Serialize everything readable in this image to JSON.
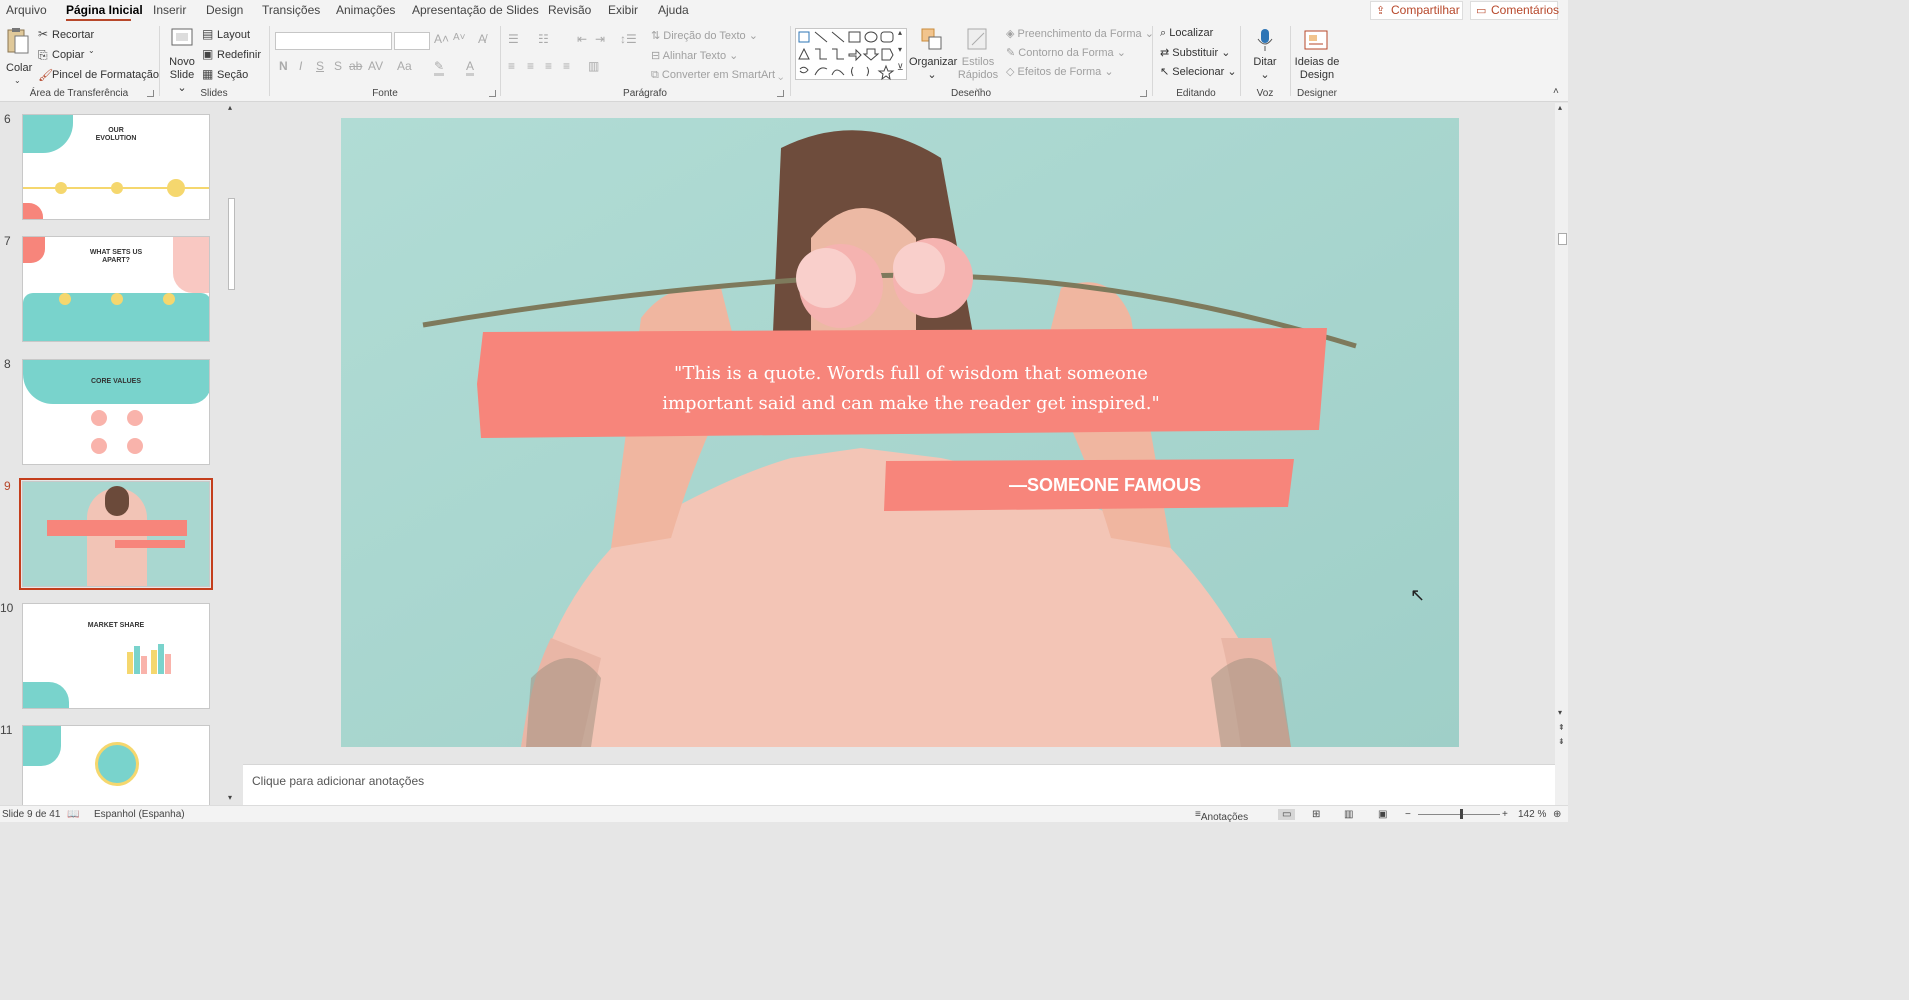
{
  "tabs": [
    "Arquivo",
    "Página Inicial",
    "Inserir",
    "Design",
    "Transições",
    "Animações",
    "Apresentação de Slides",
    "Revisão",
    "Exibir",
    "Ajuda"
  ],
  "share_label": "Compartilhar",
  "comments_label": "Comentários",
  "ribbon": {
    "clipboard": {
      "paste": "Colar",
      "cut": "Recortar",
      "copy": "Copiar",
      "format_painter": "Pincel de Formatação",
      "group": "Área de Transferência"
    },
    "slides": {
      "new_slide_1": "Novo",
      "new_slide_2": "Slide",
      "layout": "Layout",
      "reset": "Redefinir",
      "section": "Seção",
      "group": "Slides"
    },
    "font": {
      "group": "Fonte"
    },
    "paragraph": {
      "text_direction": "Direção do Texto",
      "align_text": "Alinhar Texto",
      "smartart": "Converter em SmartArt",
      "group": "Parágrafo"
    },
    "drawing": {
      "arrange": "Organizar",
      "quick_styles_1": "Estilos",
      "quick_styles_2": "Rápidos",
      "fill": "Preenchimento da Forma",
      "outline": "Contorno da Forma",
      "effects": "Efeitos de Forma",
      "group": "Desenho"
    },
    "editing": {
      "find": "Localizar",
      "replace": "Substituir",
      "select": "Selecionar",
      "group": "Editando"
    },
    "voice": {
      "dictate": "Ditar",
      "group": "Voz"
    },
    "designer": {
      "ideas_1": "Ideias de",
      "ideas_2": "Design",
      "group": "Designer"
    }
  },
  "slides_panel": [
    {
      "num": "6",
      "title": "OUR EVOLUTION"
    },
    {
      "num": "7",
      "title": "WHAT SETS US APART?"
    },
    {
      "num": "8",
      "title": "CORE VALUES"
    },
    {
      "num": "9",
      "title": ""
    },
    {
      "num": "10",
      "title": "MARKET SHARE"
    },
    {
      "num": "11",
      "title": ""
    }
  ],
  "slide": {
    "quote_line1": "\"This is a quote. Words full of wisdom that someone",
    "quote_line2": "important said and can make the reader get inspired.\"",
    "author": "—SOMEONE FAMOUS"
  },
  "notes_placeholder": "Clique para adicionar anotações",
  "status": {
    "slide_info": "Slide 9 de 41",
    "language": "Espanhol (Espanha)",
    "notes": "Anotações",
    "zoom": "142 %"
  },
  "colors": {
    "accent": "#b7472a",
    "coral": "#f7857b",
    "teal": "#a9d7d0"
  }
}
